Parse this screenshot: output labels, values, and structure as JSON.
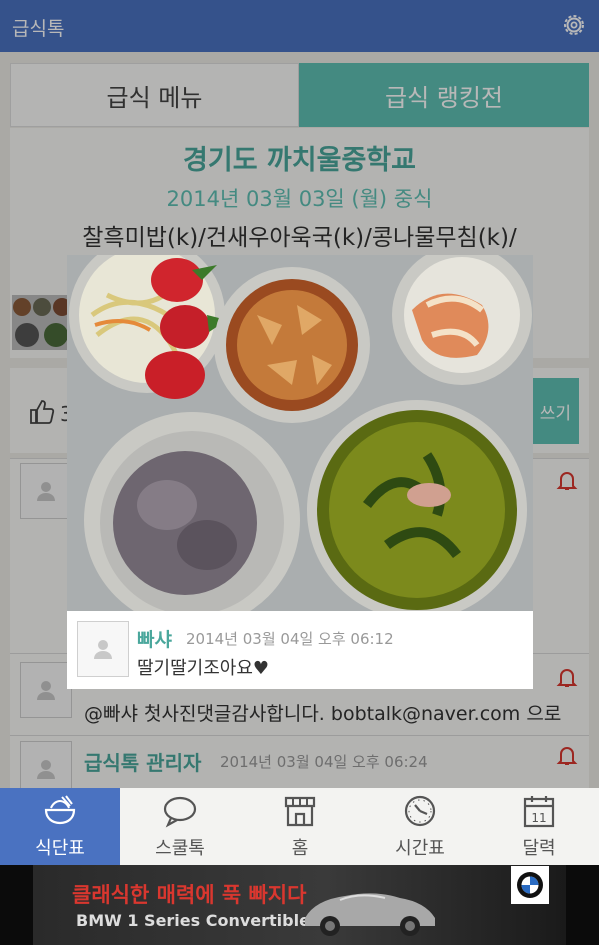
{
  "header": {
    "title": "급식톡",
    "settings_icon": "gear-icon"
  },
  "tabs": [
    {
      "label": "급식 메뉴",
      "active": false
    },
    {
      "label": "급식 랭킹전",
      "active": true
    }
  ],
  "menu": {
    "school": "경기도 까치울중학교",
    "date": "2014년 03월 03일 (월) 중식",
    "items_line": "찰흑미밥(k)/건새우아욱국(k)/콩나물무침(k)/"
  },
  "likes": {
    "count": "3",
    "write_button": "쓰기"
  },
  "comments": [
    {
      "text": "@빠샤 첫사진댓글감사합니다. bobtalk@naver.com 으로"
    },
    {
      "name": "급식톡 관리자",
      "time": "2014년 03월 04일 오후 06:24"
    }
  ],
  "popup": {
    "name": "빠샤",
    "time": "2014년 03월 04일 오후 06:12",
    "text": "딸기딸기조아요♥"
  },
  "bottom_nav": [
    {
      "label": "식단표",
      "icon": "meal-bowl-icon",
      "active": true
    },
    {
      "label": "스쿨톡",
      "icon": "speech-bubble-icon",
      "active": false
    },
    {
      "label": "홈",
      "icon": "store-icon",
      "active": false
    },
    {
      "label": "시간표",
      "icon": "clock-icon",
      "active": false
    },
    {
      "label": "달력",
      "icon": "calendar-icon",
      "active": false
    }
  ],
  "ad": {
    "headline": "클래식한 매력에 푹 빠지다",
    "sub": "BMW 1 Series Convertible",
    "logo_text": "BMW"
  },
  "colors": {
    "primary": "#4a72c1",
    "accent": "#5fbfb3",
    "alert": "#d9372f"
  }
}
